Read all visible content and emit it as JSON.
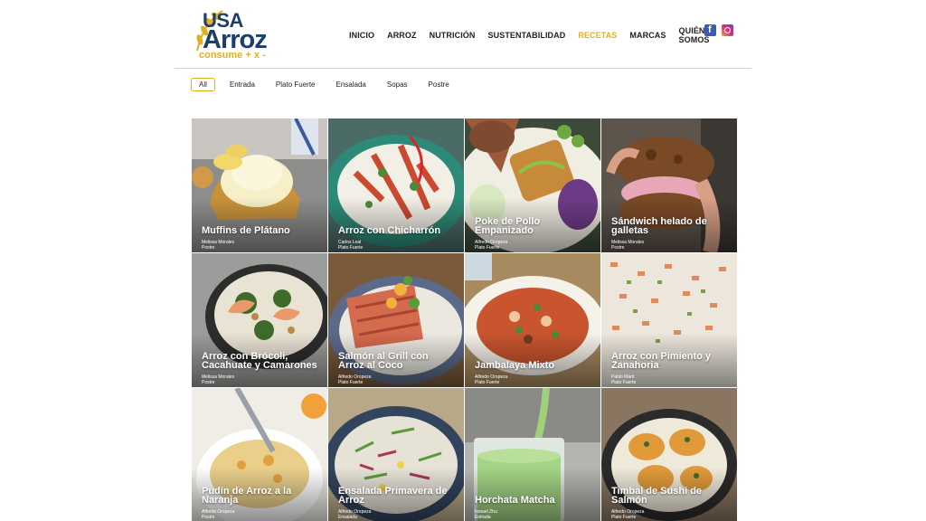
{
  "brand": {
    "line1": "USA",
    "line2": "Arroz",
    "tagline": "consume + x -",
    "color": "#1d3f6b",
    "accent": "#e0b020"
  },
  "nav": {
    "items": [
      "INICIO",
      "ARROZ",
      "NUTRICIÓN",
      "SUSTENTABILIDAD",
      "RECETAS",
      "MARCAS",
      "QUIÉNES SOMOS"
    ],
    "active": "RECETAS"
  },
  "social": [
    "facebook-icon",
    "instagram-icon"
  ],
  "filters": [
    "All",
    "Entrada",
    "Plato Fuerte",
    "Ensalada",
    "Sopas",
    "Postre"
  ],
  "selected_filter": "All",
  "recipes": [
    {
      "title": "Muffins de Plátano",
      "author": "Melissa Morales",
      "category": "Postre"
    },
    {
      "title": "Arroz con Chicharrón",
      "author": "Carlos Leal",
      "category": "Plato Fuerte"
    },
    {
      "title": "Poke de Pollo Empanizado",
      "author": "Alfredo Oropeza",
      "category": "Plato Fuerte"
    },
    {
      "title": "Sándwich helado de galletas",
      "author": "Melissa Morales",
      "category": "Postre"
    },
    {
      "title": "Arroz con Brócoli, Cacahuate y Camarones",
      "author": "Melissa Morales",
      "category": "Postre"
    },
    {
      "title": "Salmón al Grill con Arroz al Coco",
      "author": "Alfredo Oropeza",
      "category": "Plato Fuerte"
    },
    {
      "title": "Jambalaya Mixto",
      "author": "Alfredo Oropeza",
      "category": "Plato Fuerte"
    },
    {
      "title": "Arroz con Pimiento y Zanahoria",
      "author": "Pablo Martí",
      "category": "Plato Fuerte"
    },
    {
      "title": "Pudín de Arroz a la Naranja",
      "author": "Alfredo Oropeza",
      "category": "Postre"
    },
    {
      "title": "Ensalada Primavera de Arroz",
      "author": "Alfredo Oropeza",
      "category": "Ensalada"
    },
    {
      "title": "Horchata Matcha",
      "author": "Ismael Zhu",
      "category": "Entrada"
    },
    {
      "title": "Timbal de Sushi de Salmón",
      "author": "Alfredo Oropeza",
      "category": "Plato Fuerte"
    }
  ]
}
